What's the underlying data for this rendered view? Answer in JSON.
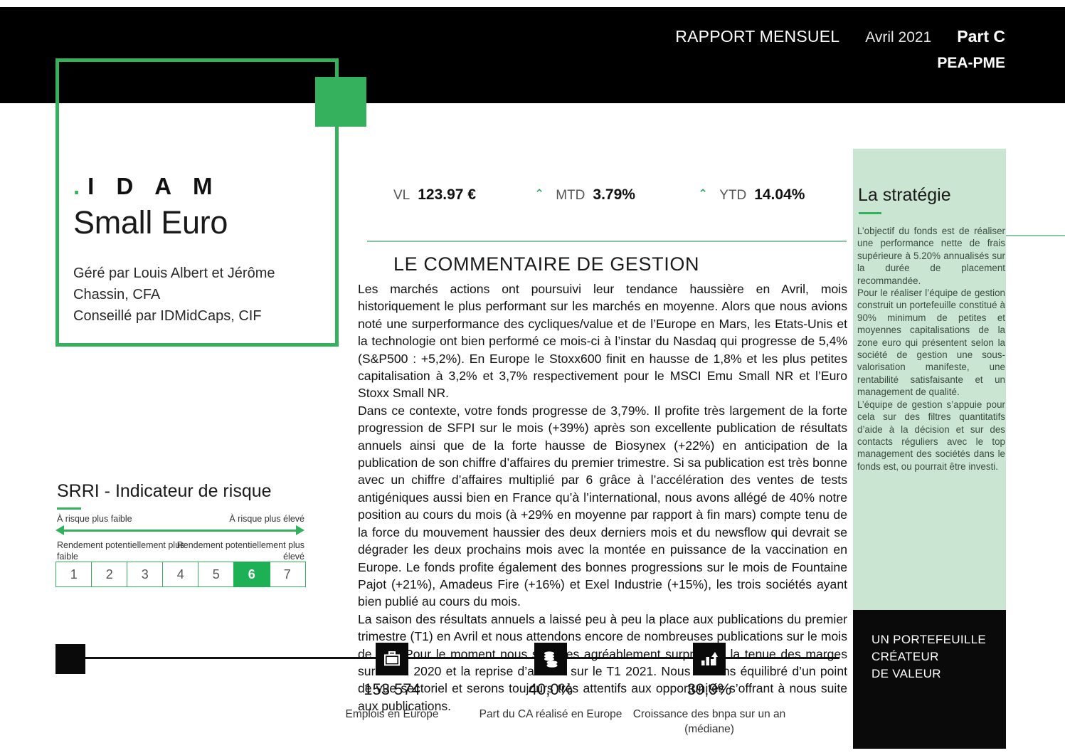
{
  "header": {
    "report_label": "RAPPORT MENSUEL",
    "period": "Avril 2021",
    "share_class": "Part C",
    "scheme": "PEA-PME"
  },
  "logo": {
    "dot": ".",
    "wordmark": "I D A M",
    "fund_name": "Small Euro",
    "managers": "Géré par Louis Albert et Jérôme Chassin, CFA",
    "advisor": "Conseillé par IDMidCaps, CIF"
  },
  "metrics": {
    "vl": {
      "label": "VL",
      "value": "123.97 €"
    },
    "mtd": {
      "arrow": "up-arrow-icon",
      "glyph": "⌃",
      "label": "MTD",
      "value": "3.79%"
    },
    "ytd": {
      "arrow": "up-arrow-icon",
      "glyph": "⌃",
      "label": "YTD",
      "value": "14.04%"
    },
    "arrow_color": "#1d9e52"
  },
  "commentary": {
    "title": "LE COMMENTAIRE DE GESTION",
    "paragraphs": [
      "Les marchés actions ont poursuivi leur tendance haussière en Avril, mois historiquement le plus performant sur les marchés en moyenne. Alors que nous avions noté une surperformance des cycliques/value et de l’Europe en Mars, les Etats-Unis et la technologie ont bien performé ce mois-ci à l’instar du Nasdaq qui progresse de 5,4% (S&P500 : +5,2%). En Europe le Stoxx600 finit en hausse de 1,8% et les plus petites capitalisation à 3,2% et 3,7% respectivement pour le MSCI Emu Small NR et l’Euro Stoxx Small NR.",
      "Dans ce contexte, votre fonds progresse de 3,79%. Il profite très largement de la forte progression de SFPI sur le mois (+39%) après son excellente publication de résultats annuels ainsi que de la forte hausse de Biosynex (+22%) en anticipation de la publication de son chiffre d’affaires du premier trimestre. Si sa publication est très bonne avec un chiffre d’affaires multiplié par 6 grâce à l’accélération des ventes de tests antigéniques aussi bien en France qu’à l’international, nous avons allégé  de 40% notre position au cours du mois  (à +29% en moyenne par rapport à fin mars) compte tenu de la force du mouvement haussier des deux derniers mois et du newsflow qui devrait se dégrader les deux prochains mois avec la montée en puissance de la vaccination en Europe. Le fonds profite également des bonnes progressions sur le mois de Fountaine Pajot (+21%), Amadeus Fire (+16%) et Exel Industrie (+15%), les trois sociétés ayant bien publié au cours du mois.",
      "La saison des résultats annuels a laissé peu à peu la place aux publications du premier trimestre (T1) en Avril et nous attendons encore de nombreuses publications sur le mois de Mai. Pour le moment nous sommes agréablement surpris par la tenue des marges sur le S2 2020 et la reprise d’activité sur le T1 2021. Nous restons équilibré d’un point de vue sectoriel et serons toujours très attentifs aux opportunités s’offrant à nous suite aux publications."
    ]
  },
  "strategy": {
    "title": "La stratégie",
    "paragraphs": [
      "L’objectif du fonds est de réaliser une performance nette de frais supérieure à 5.20% annualisés sur la durée de placement recommandée.",
      "Pour le réaliser l’équipe de gestion construit un portefeuille constitué à 90% minimum de petites et moyennes capitalisations de la zone euro qui présentent selon la société de gestion une sous-valorisation manifeste, une rentabilité satisfaisante et un management de qualité.",
      "L’équipe de gestion s’appuie pour cela sur des filtres quantitatifs d’aide à la décision et sur des contacts réguliers avec le top management des sociétés dans le fonds est, ou pourrait être investi."
    ],
    "background_color": "#cbe5d3"
  },
  "value_panel": {
    "lines": [
      "UN PORTEFEUILLE",
      "CRÉATEUR",
      "DE VALEUR"
    ],
    "text": "UN PORTEFEUILLE CRÉATEUR DE VALEUR"
  },
  "srri": {
    "title": "SRRI - Indicateur de risque",
    "label_low": "À risque plus faible",
    "label_high": "À risque plus élevé",
    "return_low": "Rendement potentiellement plus faible",
    "return_high": "Rendement  potentiellement plus élevé",
    "scale": [
      "1",
      "2",
      "3",
      "4",
      "5",
      "6",
      "7"
    ],
    "active_value": "6",
    "active_color": "#1db055"
  },
  "timeline": {
    "stats": [
      {
        "icon": "briefcase-icon",
        "value": "153 574",
        "label": "Emplois en Europe"
      },
      {
        "icon": "coins-stack-icon",
        "value": "40,0%",
        "label": "Part du CA réalisé en Europe"
      },
      {
        "icon": "bar-chart-growth-icon",
        "value": "39,9%",
        "label": "Croissance des bnpa sur un an (médiane)"
      }
    ]
  },
  "colors": {
    "brand_green": "#35b15d",
    "light_green": "#cbe5d3",
    "divider_green": "#8cc3a2",
    "black": "#000000"
  }
}
